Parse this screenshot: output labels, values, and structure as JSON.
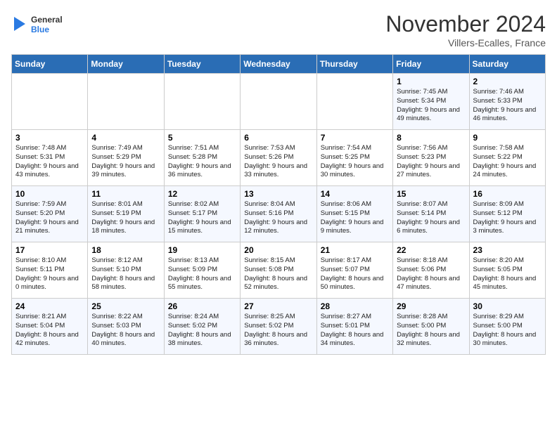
{
  "header": {
    "logo_line1": "General",
    "logo_line2": "Blue",
    "month_title": "November 2024",
    "subtitle": "Villers-Ecalles, France"
  },
  "weekdays": [
    "Sunday",
    "Monday",
    "Tuesday",
    "Wednesday",
    "Thursday",
    "Friday",
    "Saturday"
  ],
  "weeks": [
    [
      {
        "day": "",
        "info": ""
      },
      {
        "day": "",
        "info": ""
      },
      {
        "day": "",
        "info": ""
      },
      {
        "day": "",
        "info": ""
      },
      {
        "day": "",
        "info": ""
      },
      {
        "day": "1",
        "info": "Sunrise: 7:45 AM\nSunset: 5:34 PM\nDaylight: 9 hours and 49 minutes."
      },
      {
        "day": "2",
        "info": "Sunrise: 7:46 AM\nSunset: 5:33 PM\nDaylight: 9 hours and 46 minutes."
      }
    ],
    [
      {
        "day": "3",
        "info": "Sunrise: 7:48 AM\nSunset: 5:31 PM\nDaylight: 9 hours and 43 minutes."
      },
      {
        "day": "4",
        "info": "Sunrise: 7:49 AM\nSunset: 5:29 PM\nDaylight: 9 hours and 39 minutes."
      },
      {
        "day": "5",
        "info": "Sunrise: 7:51 AM\nSunset: 5:28 PM\nDaylight: 9 hours and 36 minutes."
      },
      {
        "day": "6",
        "info": "Sunrise: 7:53 AM\nSunset: 5:26 PM\nDaylight: 9 hours and 33 minutes."
      },
      {
        "day": "7",
        "info": "Sunrise: 7:54 AM\nSunset: 5:25 PM\nDaylight: 9 hours and 30 minutes."
      },
      {
        "day": "8",
        "info": "Sunrise: 7:56 AM\nSunset: 5:23 PM\nDaylight: 9 hours and 27 minutes."
      },
      {
        "day": "9",
        "info": "Sunrise: 7:58 AM\nSunset: 5:22 PM\nDaylight: 9 hours and 24 minutes."
      }
    ],
    [
      {
        "day": "10",
        "info": "Sunrise: 7:59 AM\nSunset: 5:20 PM\nDaylight: 9 hours and 21 minutes."
      },
      {
        "day": "11",
        "info": "Sunrise: 8:01 AM\nSunset: 5:19 PM\nDaylight: 9 hours and 18 minutes."
      },
      {
        "day": "12",
        "info": "Sunrise: 8:02 AM\nSunset: 5:17 PM\nDaylight: 9 hours and 15 minutes."
      },
      {
        "day": "13",
        "info": "Sunrise: 8:04 AM\nSunset: 5:16 PM\nDaylight: 9 hours and 12 minutes."
      },
      {
        "day": "14",
        "info": "Sunrise: 8:06 AM\nSunset: 5:15 PM\nDaylight: 9 hours and 9 minutes."
      },
      {
        "day": "15",
        "info": "Sunrise: 8:07 AM\nSunset: 5:14 PM\nDaylight: 9 hours and 6 minutes."
      },
      {
        "day": "16",
        "info": "Sunrise: 8:09 AM\nSunset: 5:12 PM\nDaylight: 9 hours and 3 minutes."
      }
    ],
    [
      {
        "day": "17",
        "info": "Sunrise: 8:10 AM\nSunset: 5:11 PM\nDaylight: 9 hours and 0 minutes."
      },
      {
        "day": "18",
        "info": "Sunrise: 8:12 AM\nSunset: 5:10 PM\nDaylight: 8 hours and 58 minutes."
      },
      {
        "day": "19",
        "info": "Sunrise: 8:13 AM\nSunset: 5:09 PM\nDaylight: 8 hours and 55 minutes."
      },
      {
        "day": "20",
        "info": "Sunrise: 8:15 AM\nSunset: 5:08 PM\nDaylight: 8 hours and 52 minutes."
      },
      {
        "day": "21",
        "info": "Sunrise: 8:17 AM\nSunset: 5:07 PM\nDaylight: 8 hours and 50 minutes."
      },
      {
        "day": "22",
        "info": "Sunrise: 8:18 AM\nSunset: 5:06 PM\nDaylight: 8 hours and 47 minutes."
      },
      {
        "day": "23",
        "info": "Sunrise: 8:20 AM\nSunset: 5:05 PM\nDaylight: 8 hours and 45 minutes."
      }
    ],
    [
      {
        "day": "24",
        "info": "Sunrise: 8:21 AM\nSunset: 5:04 PM\nDaylight: 8 hours and 42 minutes."
      },
      {
        "day": "25",
        "info": "Sunrise: 8:22 AM\nSunset: 5:03 PM\nDaylight: 8 hours and 40 minutes."
      },
      {
        "day": "26",
        "info": "Sunrise: 8:24 AM\nSunset: 5:02 PM\nDaylight: 8 hours and 38 minutes."
      },
      {
        "day": "27",
        "info": "Sunrise: 8:25 AM\nSunset: 5:02 PM\nDaylight: 8 hours and 36 minutes."
      },
      {
        "day": "28",
        "info": "Sunrise: 8:27 AM\nSunset: 5:01 PM\nDaylight: 8 hours and 34 minutes."
      },
      {
        "day": "29",
        "info": "Sunrise: 8:28 AM\nSunset: 5:00 PM\nDaylight: 8 hours and 32 minutes."
      },
      {
        "day": "30",
        "info": "Sunrise: 8:29 AM\nSunset: 5:00 PM\nDaylight: 8 hours and 30 minutes."
      }
    ]
  ]
}
